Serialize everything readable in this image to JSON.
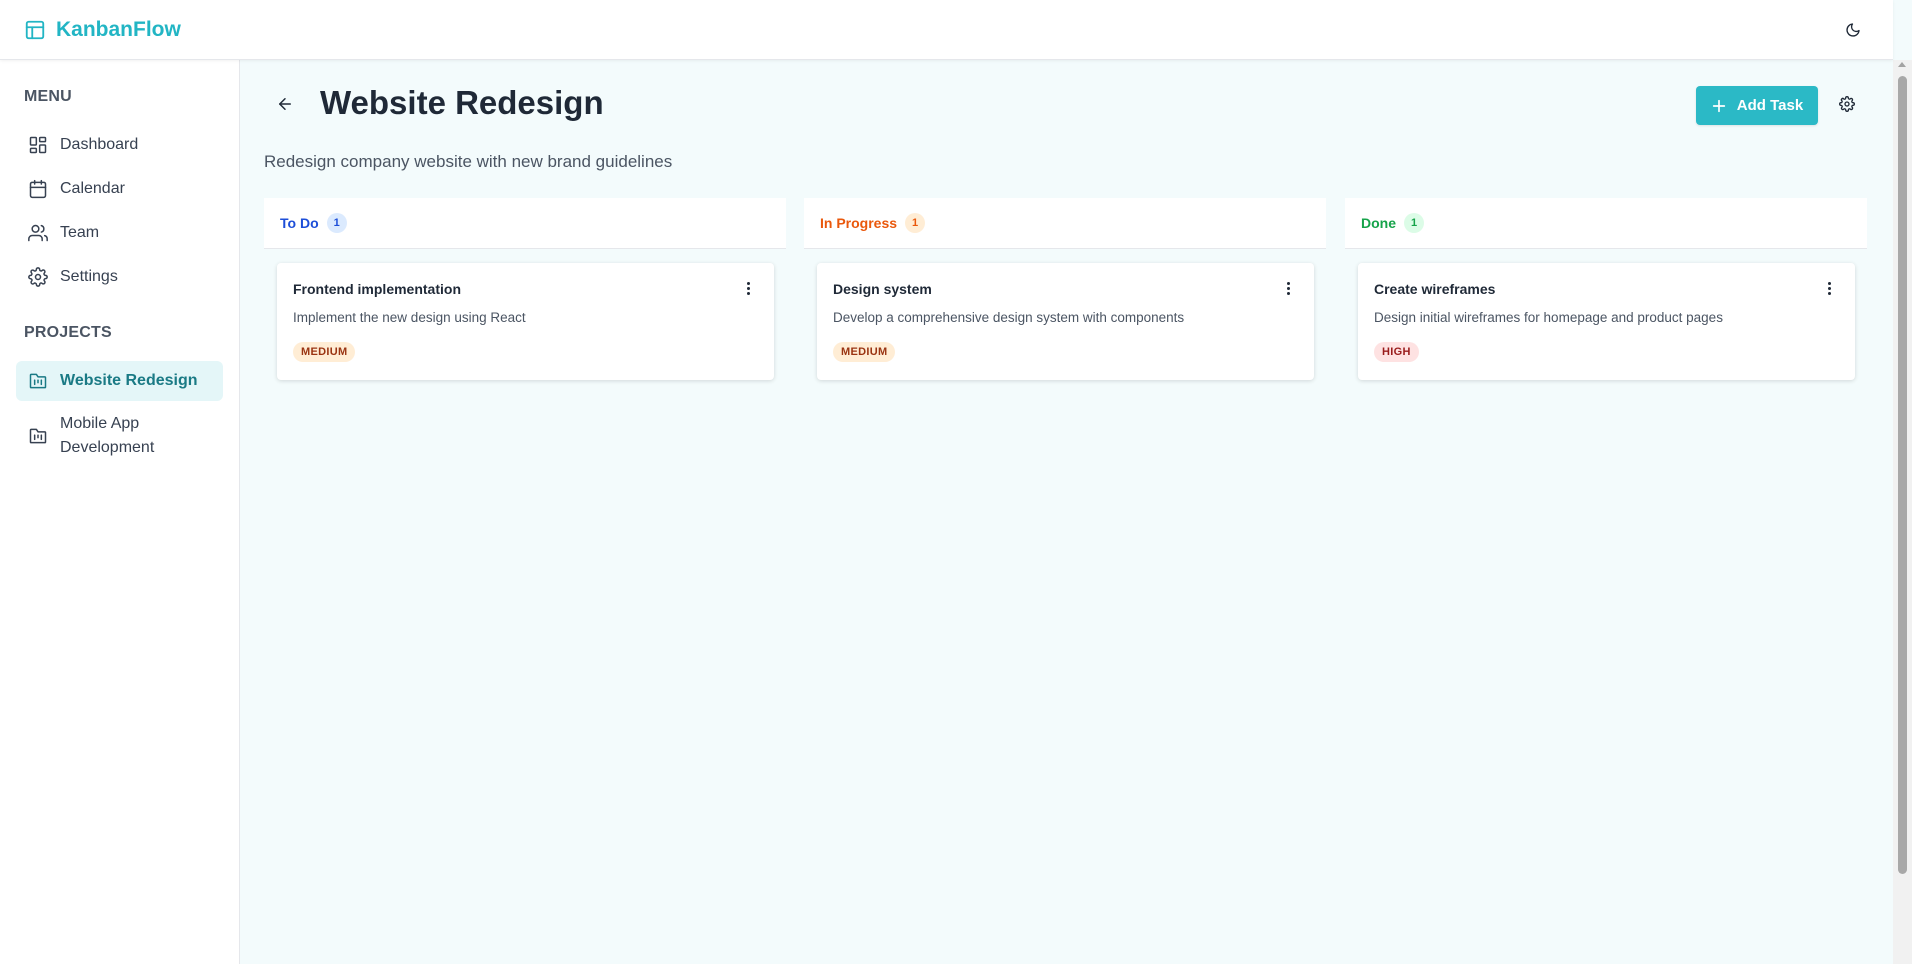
{
  "app": {
    "name": "KanbanFlow"
  },
  "sidebar": {
    "menu_label": "MENU",
    "menu_items": [
      {
        "label": "Dashboard",
        "icon": "dashboard-icon"
      },
      {
        "label": "Calendar",
        "icon": "calendar-icon"
      },
      {
        "label": "Team",
        "icon": "users-icon"
      },
      {
        "label": "Settings",
        "icon": "gear-icon"
      }
    ],
    "projects_label": "PROJECTS",
    "projects": [
      {
        "label": "Website Redesign",
        "icon": "board-icon",
        "active": true
      },
      {
        "label": "Mobile App Development",
        "icon": "board-icon",
        "active": false
      }
    ]
  },
  "project": {
    "title": "Website Redesign",
    "description": "Redesign company website with new brand guidelines",
    "add_task_label": "Add Task"
  },
  "columns": [
    {
      "title": "To Do",
      "count": "1",
      "color": "#1d4ed8",
      "count_bg": "#dbeafe",
      "cards": [
        {
          "title": "Frontend implementation",
          "description": "Implement the new design using React",
          "priority": "MEDIUM",
          "priority_color": "#9a3412",
          "priority_bg": "#ffedd5"
        }
      ]
    },
    {
      "title": "In Progress",
      "count": "1",
      "color": "#ea580c",
      "count_bg": "#ffedd5",
      "cards": [
        {
          "title": "Design system",
          "description": "Develop a comprehensive design system with components",
          "priority": "MEDIUM",
          "priority_color": "#9a3412",
          "priority_bg": "#ffedd5"
        }
      ]
    },
    {
      "title": "Done",
      "count": "1",
      "color": "#16a34a",
      "count_bg": "#dcfce7",
      "cards": [
        {
          "title": "Create wireframes",
          "description": "Design initial wireframes for homepage and product pages",
          "priority": "HIGH",
          "priority_color": "#991b1b",
          "priority_bg": "#fee2e2"
        }
      ]
    }
  ],
  "colors": {
    "accent": "#2bb9c6",
    "brand": "#22b5c4",
    "background": "#f3fbfc"
  }
}
